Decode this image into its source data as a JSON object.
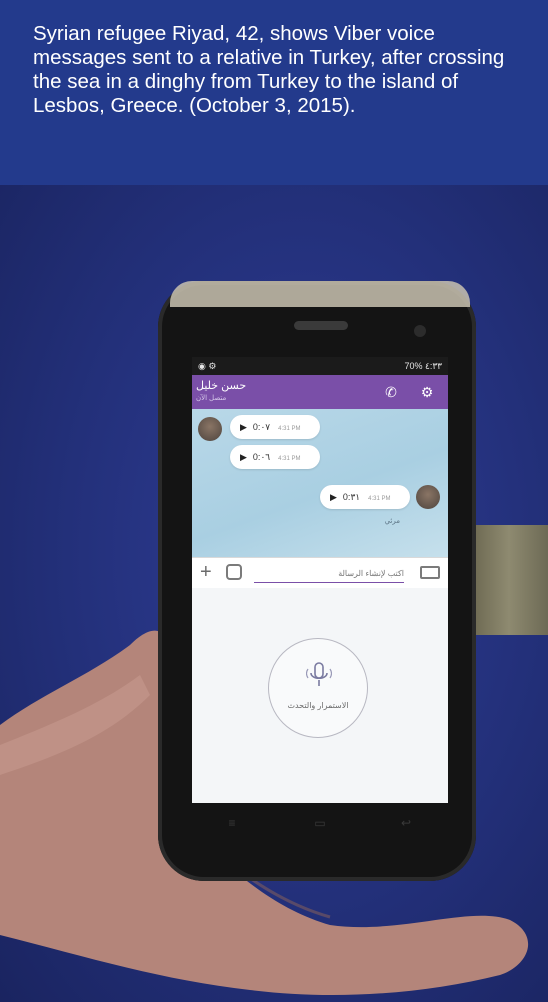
{
  "caption": {
    "text": "Syrian refugee Riyad, 42, shows Viber voice messages sent to a relative in Turkey, after crossing the sea in a dinghy from Turkey to the island of Lesbos, Greece. (October 3, 2015)."
  },
  "phone_screen": {
    "status": {
      "battery": "70%",
      "time": "٤:٣٣"
    },
    "header": {
      "contact_name": "حسن خليل",
      "contact_subtitle": "متصل الآن"
    },
    "messages": [
      {
        "duration": "0:٠٧",
        "time": "4:31 PM"
      },
      {
        "duration": "0:٠٦",
        "time": "4:31 PM"
      },
      {
        "duration": "0:٣١",
        "time": "4:31 PM"
      }
    ],
    "seen_label": "مرئي",
    "input_placeholder": "اكتب لإنشاء الرسالة",
    "record_label": "الاستمرار والتحدث"
  },
  "colors": {
    "caption_background": "#233a8c",
    "viber_purple": "#7a4fa8",
    "backdrop_blue": "#2f3d96"
  },
  "icons": [
    "phone-call-icon",
    "settings-icon",
    "play-icon",
    "plus-icon",
    "sticker-icon",
    "keyboard-icon",
    "microphone-icon",
    "menu-key-icon",
    "home-key-icon",
    "back-key-icon"
  ]
}
